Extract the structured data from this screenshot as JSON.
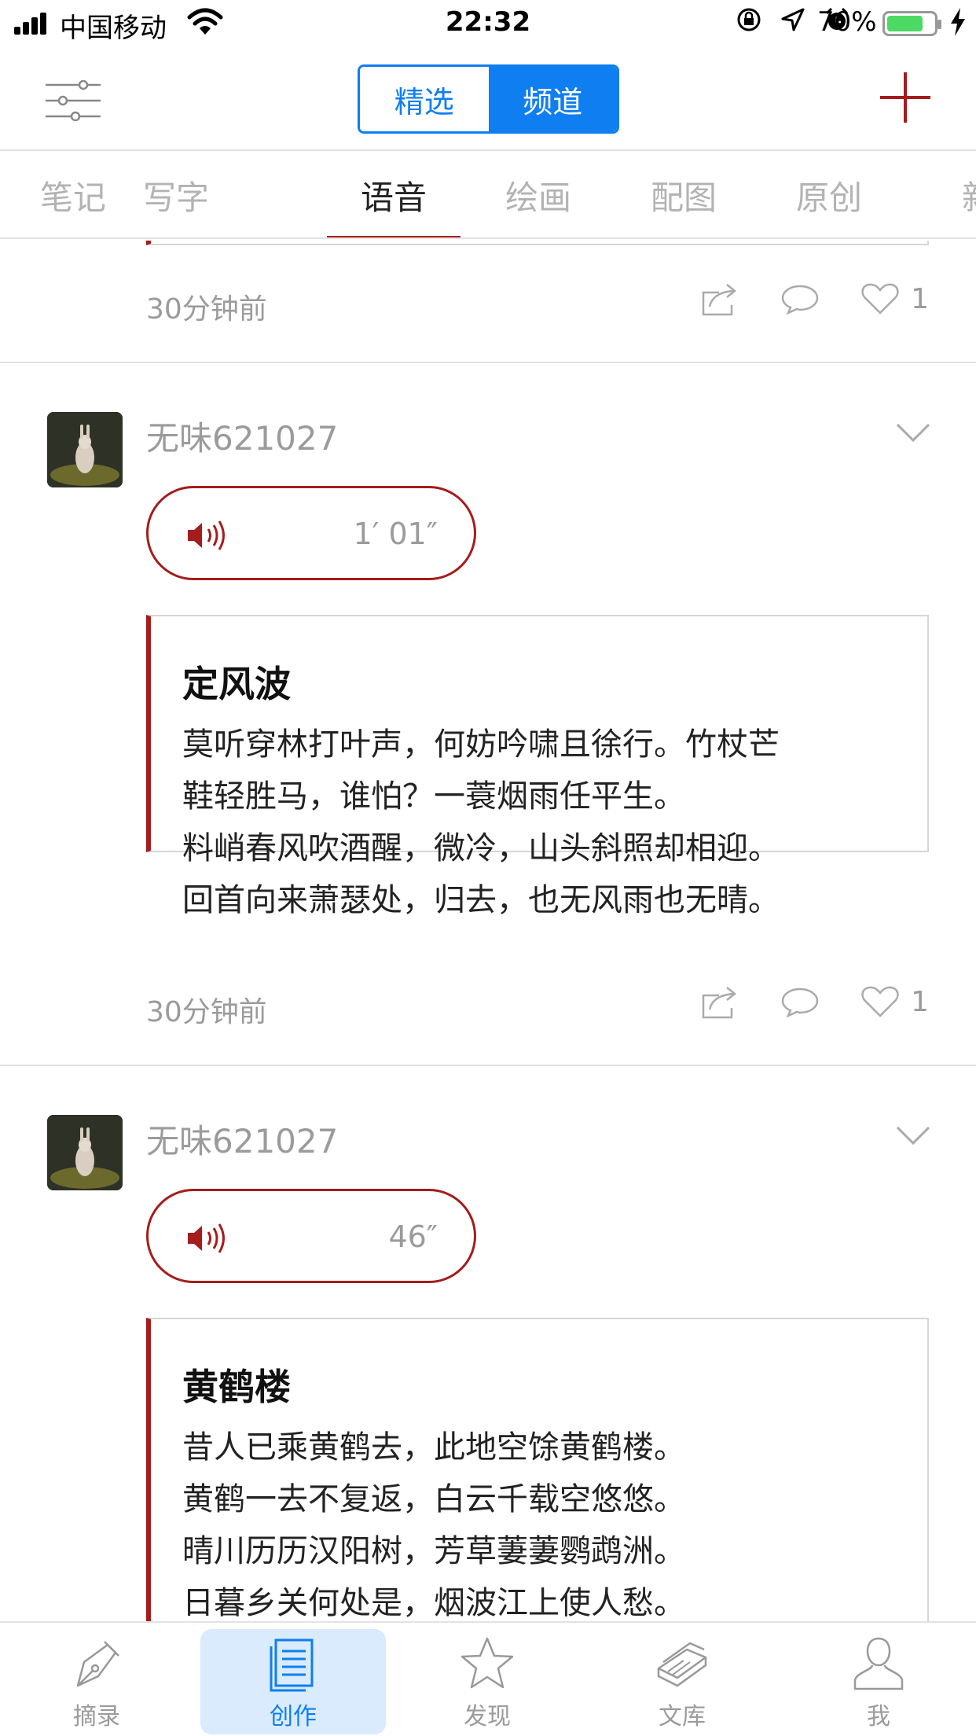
{
  "status_bar": {
    "carrier": "中国移动",
    "time": "22:32",
    "battery": "70%",
    "battery_level": 0.7,
    "icons": [
      "signal-icon",
      "wifi-icon",
      "orientation-lock-icon",
      "location-icon",
      "alarm-icon",
      "battery-icon",
      "charging-icon"
    ]
  },
  "header": {
    "segments": [
      "精选",
      "频道"
    ],
    "active_segment": "频道"
  },
  "tabs": [
    "笔记",
    "写字",
    "语音",
    "绘画",
    "配图",
    "原创",
    "新"
  ],
  "active_tab": "语音",
  "colors": {
    "accent": "#a51c1c",
    "blue": "#0f7ef0",
    "muted": "#9b9b9b"
  },
  "top_item": {
    "time": "30分钟前",
    "likes": "1"
  },
  "posts": [
    {
      "user": "无味621027",
      "duration": "1′ 01″",
      "title": "定风波",
      "lines": [
        "莫听穿林打叶声，何妨吟啸且徐行。竹杖芒",
        "鞋轻胜马，谁怕？一蓑烟雨任平生。",
        "料峭春风吹酒醒，微冷，山头斜照却相迎。",
        "回首向来萧瑟处，归去，也无风雨也无晴。"
      ],
      "time": "30分钟前",
      "likes": "1"
    },
    {
      "user": "无味621027",
      "duration": "46″",
      "title": "黄鹤楼",
      "lines": [
        "昔人已乘黄鹤去，此地空馀黄鹤楼。",
        "黄鹤一去不复返，白云千载空悠悠。",
        "晴川历历汉阳树，芳草萋萋鹦鹉洲。",
        "日暮乡关何处是，烟波江上使人愁。"
      ]
    }
  ],
  "tabbar": [
    {
      "label": "摘录",
      "icon": "pen-nib-icon"
    },
    {
      "label": "创作",
      "icon": "document-icon"
    },
    {
      "label": "发现",
      "icon": "star-icon"
    },
    {
      "label": "文库",
      "icon": "books-icon"
    },
    {
      "label": "我",
      "icon": "person-icon"
    }
  ],
  "tabbar_active": "创作"
}
